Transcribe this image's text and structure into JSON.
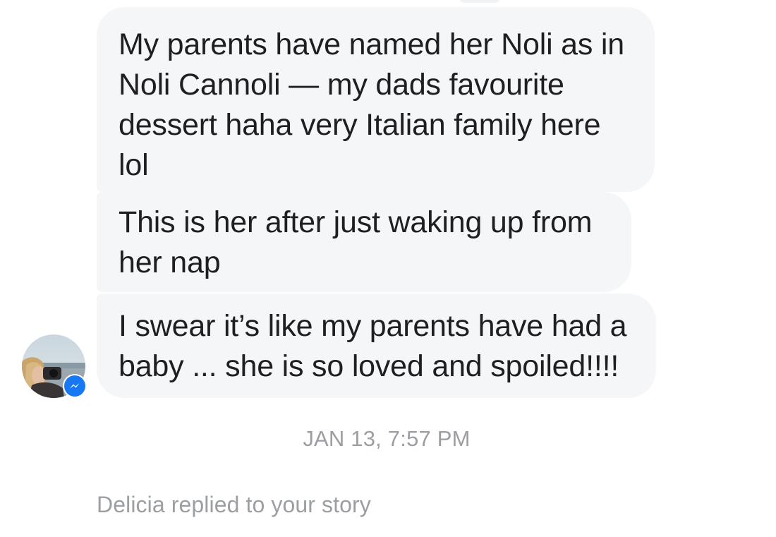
{
  "conversation": {
    "messages": [
      {
        "lines": [
          "My parents have named her Noli as in",
          "Noli Cannoli — my dads favourite",
          "dessert haha very Italian family here",
          "lol"
        ]
      },
      {
        "lines": [
          "This is her after just waking up from",
          "her nap"
        ]
      },
      {
        "lines": [
          "I swear it’s like my parents have had a",
          "baby ... she is so loved and spoiled!!!!"
        ]
      }
    ],
    "timestamp": "JAN 13, 7:57 PM",
    "system_note": "Delicia replied to your story"
  },
  "icons": {
    "avatar": "sender-avatar-photo",
    "badge": "messenger-badge-icon"
  },
  "colors": {
    "bubble": "#f5f6f8",
    "meta_text": "#9b9ea3",
    "messenger_blue": "#1877f2"
  }
}
